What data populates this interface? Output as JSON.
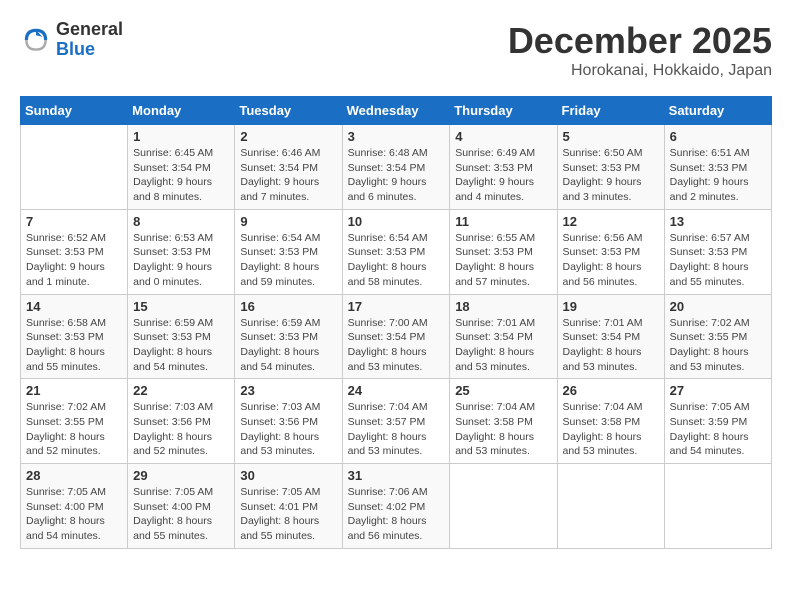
{
  "logo": {
    "general": "General",
    "blue": "Blue"
  },
  "header": {
    "month": "December 2025",
    "location": "Horokanai, Hokkaido, Japan"
  },
  "weekdays": [
    "Sunday",
    "Monday",
    "Tuesday",
    "Wednesday",
    "Thursday",
    "Friday",
    "Saturday"
  ],
  "weeks": [
    [
      {
        "day": "",
        "info": ""
      },
      {
        "day": "1",
        "info": "Sunrise: 6:45 AM\nSunset: 3:54 PM\nDaylight: 9 hours\nand 8 minutes."
      },
      {
        "day": "2",
        "info": "Sunrise: 6:46 AM\nSunset: 3:54 PM\nDaylight: 9 hours\nand 7 minutes."
      },
      {
        "day": "3",
        "info": "Sunrise: 6:48 AM\nSunset: 3:54 PM\nDaylight: 9 hours\nand 6 minutes."
      },
      {
        "day": "4",
        "info": "Sunrise: 6:49 AM\nSunset: 3:53 PM\nDaylight: 9 hours\nand 4 minutes."
      },
      {
        "day": "5",
        "info": "Sunrise: 6:50 AM\nSunset: 3:53 PM\nDaylight: 9 hours\nand 3 minutes."
      },
      {
        "day": "6",
        "info": "Sunrise: 6:51 AM\nSunset: 3:53 PM\nDaylight: 9 hours\nand 2 minutes."
      }
    ],
    [
      {
        "day": "7",
        "info": "Sunrise: 6:52 AM\nSunset: 3:53 PM\nDaylight: 9 hours\nand 1 minute."
      },
      {
        "day": "8",
        "info": "Sunrise: 6:53 AM\nSunset: 3:53 PM\nDaylight: 9 hours\nand 0 minutes."
      },
      {
        "day": "9",
        "info": "Sunrise: 6:54 AM\nSunset: 3:53 PM\nDaylight: 8 hours\nand 59 minutes."
      },
      {
        "day": "10",
        "info": "Sunrise: 6:54 AM\nSunset: 3:53 PM\nDaylight: 8 hours\nand 58 minutes."
      },
      {
        "day": "11",
        "info": "Sunrise: 6:55 AM\nSunset: 3:53 PM\nDaylight: 8 hours\nand 57 minutes."
      },
      {
        "day": "12",
        "info": "Sunrise: 6:56 AM\nSunset: 3:53 PM\nDaylight: 8 hours\nand 56 minutes."
      },
      {
        "day": "13",
        "info": "Sunrise: 6:57 AM\nSunset: 3:53 PM\nDaylight: 8 hours\nand 55 minutes."
      }
    ],
    [
      {
        "day": "14",
        "info": "Sunrise: 6:58 AM\nSunset: 3:53 PM\nDaylight: 8 hours\nand 55 minutes."
      },
      {
        "day": "15",
        "info": "Sunrise: 6:59 AM\nSunset: 3:53 PM\nDaylight: 8 hours\nand 54 minutes."
      },
      {
        "day": "16",
        "info": "Sunrise: 6:59 AM\nSunset: 3:53 PM\nDaylight: 8 hours\nand 54 minutes."
      },
      {
        "day": "17",
        "info": "Sunrise: 7:00 AM\nSunset: 3:54 PM\nDaylight: 8 hours\nand 53 minutes."
      },
      {
        "day": "18",
        "info": "Sunrise: 7:01 AM\nSunset: 3:54 PM\nDaylight: 8 hours\nand 53 minutes."
      },
      {
        "day": "19",
        "info": "Sunrise: 7:01 AM\nSunset: 3:54 PM\nDaylight: 8 hours\nand 53 minutes."
      },
      {
        "day": "20",
        "info": "Sunrise: 7:02 AM\nSunset: 3:55 PM\nDaylight: 8 hours\nand 53 minutes."
      }
    ],
    [
      {
        "day": "21",
        "info": "Sunrise: 7:02 AM\nSunset: 3:55 PM\nDaylight: 8 hours\nand 52 minutes."
      },
      {
        "day": "22",
        "info": "Sunrise: 7:03 AM\nSunset: 3:56 PM\nDaylight: 8 hours\nand 52 minutes."
      },
      {
        "day": "23",
        "info": "Sunrise: 7:03 AM\nSunset: 3:56 PM\nDaylight: 8 hours\nand 53 minutes."
      },
      {
        "day": "24",
        "info": "Sunrise: 7:04 AM\nSunset: 3:57 PM\nDaylight: 8 hours\nand 53 minutes."
      },
      {
        "day": "25",
        "info": "Sunrise: 7:04 AM\nSunset: 3:58 PM\nDaylight: 8 hours\nand 53 minutes."
      },
      {
        "day": "26",
        "info": "Sunrise: 7:04 AM\nSunset: 3:58 PM\nDaylight: 8 hours\nand 53 minutes."
      },
      {
        "day": "27",
        "info": "Sunrise: 7:05 AM\nSunset: 3:59 PM\nDaylight: 8 hours\nand 54 minutes."
      }
    ],
    [
      {
        "day": "28",
        "info": "Sunrise: 7:05 AM\nSunset: 4:00 PM\nDaylight: 8 hours\nand 54 minutes."
      },
      {
        "day": "29",
        "info": "Sunrise: 7:05 AM\nSunset: 4:00 PM\nDaylight: 8 hours\nand 55 minutes."
      },
      {
        "day": "30",
        "info": "Sunrise: 7:05 AM\nSunset: 4:01 PM\nDaylight: 8 hours\nand 55 minutes."
      },
      {
        "day": "31",
        "info": "Sunrise: 7:06 AM\nSunset: 4:02 PM\nDaylight: 8 hours\nand 56 minutes."
      },
      {
        "day": "",
        "info": ""
      },
      {
        "day": "",
        "info": ""
      },
      {
        "day": "",
        "info": ""
      }
    ]
  ]
}
